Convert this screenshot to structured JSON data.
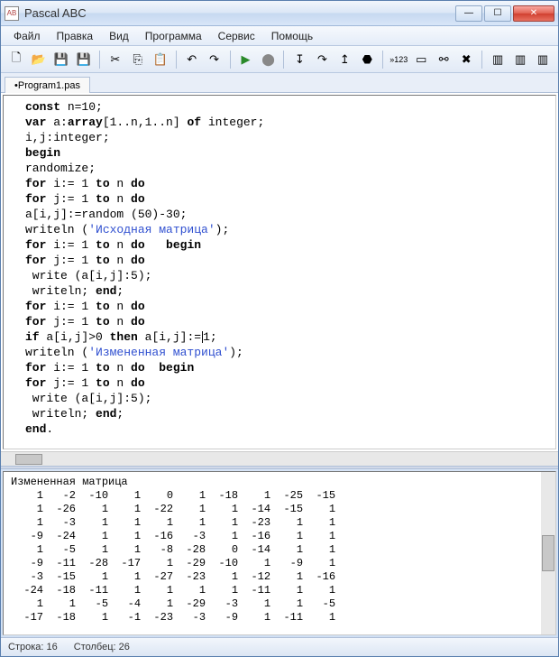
{
  "window": {
    "title": "Pascal ABC",
    "min": "—",
    "max": "☐",
    "close": "✕"
  },
  "menu": {
    "file": "Файл",
    "edit": "Правка",
    "view": "Вид",
    "program": "Программа",
    "service": "Сервис",
    "help": "Помощь"
  },
  "tabs": {
    "file1": "•Program1.pas"
  },
  "code": {
    "l1a": "const",
    "l1b": " n=10;",
    "l2a": "var",
    "l2b": " a:",
    "l2c": "array",
    "l2d": "[1..n,1..n] ",
    "l2e": "of",
    "l2f": " integer;",
    "l3": "i,j:integer;",
    "l4": "begin",
    "l5": "randomize;",
    "l6a": "for",
    "l6b": " i:= 1 ",
    "l6c": "to",
    "l6d": " n ",
    "l6e": "do",
    "l7a": "for",
    "l7b": " j:= 1 ",
    "l7c": "to",
    "l7d": " n ",
    "l7e": "do",
    "l8": "a[i,j]:=random (50)-30;",
    "l9a": "writeln (",
    "l9b": "'Исходная матрица'",
    "l9c": ");",
    "l10a": "for",
    "l10b": " i:= 1 ",
    "l10c": "to",
    "l10d": " n ",
    "l10e": "do",
    "l10f": "   ",
    "l10g": "begin",
    "l11a": "for",
    "l11b": " j:= 1 ",
    "l11c": "to",
    "l11d": " n ",
    "l11e": "do",
    "l12": " write (a[i,j]:5);",
    "l13a": " writeln; ",
    "l13b": "end",
    "l13c": ";",
    "l14a": "for",
    "l14b": " i:= 1 ",
    "l14c": "to",
    "l14d": " n ",
    "l14e": "do",
    "l15a": "for",
    "l15b": " j:= 1 ",
    "l15c": "to",
    "l15d": " n ",
    "l15e": "do",
    "l16a": "if",
    "l16b": " a[i,j]>0 ",
    "l16c": "then",
    "l16d": " a[i,j]:=",
    "l16e": "1;",
    "l17a": "writeln (",
    "l17b": "'Измененная матрица'",
    "l17c": ");",
    "l18a": "for",
    "l18b": " i:= 1 ",
    "l18c": "to",
    "l18d": " n ",
    "l18e": "do",
    "l18f": "  ",
    "l18g": "begin",
    "l19a": "for",
    "l19b": " j:= 1 ",
    "l19c": "to",
    "l19d": " n ",
    "l19e": "do",
    "l20": " write (a[i,j]:5);",
    "l21a": " writeln; ",
    "l21b": "end",
    "l21c": ";",
    "l22a": "end",
    "l22b": "."
  },
  "output": {
    "title": "Измененная матрица",
    "rows": [
      "    1   -2  -10    1    0    1  -18    1  -25  -15",
      "    1  -26    1    1  -22    1    1  -14  -15    1",
      "    1   -3    1    1    1    1    1  -23    1    1",
      "   -9  -24    1    1  -16   -3    1  -16    1    1",
      "    1   -5    1    1   -8  -28    0  -14    1    1",
      "   -9  -11  -28  -17    1  -29  -10    1   -9    1",
      "   -3  -15    1    1  -27  -23    1  -12    1  -16",
      "  -24  -18  -11    1    1    1    1  -11    1    1",
      "    1    1   -5   -4    1  -29   -3    1    1   -5",
      "  -17  -18    1   -1  -23   -3   -9    1  -11    1"
    ]
  },
  "status": {
    "line_label": "Строка:",
    "line_value": "16",
    "col_label": "Столбец:",
    "col_value": "26"
  }
}
